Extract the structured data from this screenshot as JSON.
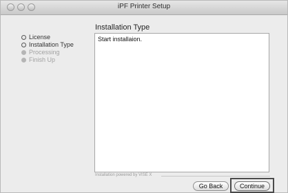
{
  "window": {
    "title": "iPF Printer Setup"
  },
  "sidebar": {
    "steps": [
      {
        "label": "License",
        "state": "done"
      },
      {
        "label": "Installation Type",
        "state": "done"
      },
      {
        "label": "Processing",
        "state": "pending"
      },
      {
        "label": "Finish Up",
        "state": "pending"
      }
    ]
  },
  "main": {
    "heading": "Installation Type",
    "content_text": "Start installaion."
  },
  "footer": {
    "powered_by": "Installation powered by VISE X",
    "back_label": "Go Back",
    "continue_label": "Continue"
  }
}
